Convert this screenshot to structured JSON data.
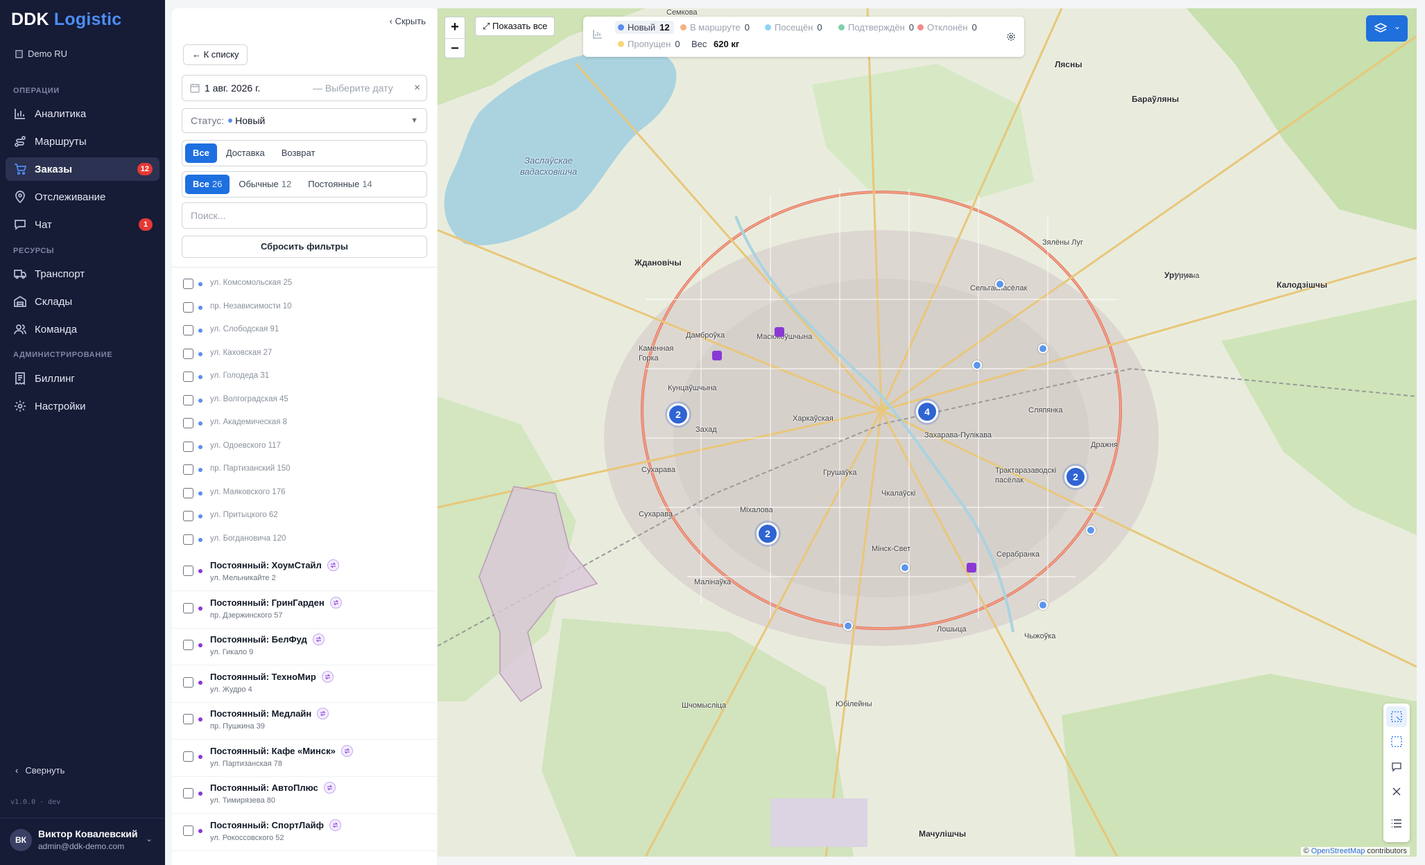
{
  "brand": {
    "part1": "DDK",
    "part2": "Logistic"
  },
  "org": "Demo RU",
  "sidebar": {
    "sections": [
      "ОПЕРАЦИИ",
      "РЕСУРСЫ",
      "АДМИНИСТРИРОВАНИЕ"
    ],
    "items": [
      {
        "label": "Аналитика",
        "icon": "chart-icon"
      },
      {
        "label": "Маршруты",
        "icon": "route-icon"
      },
      {
        "label": "Заказы",
        "icon": "cart-icon",
        "badge": "12",
        "active": true
      },
      {
        "label": "Отслеживание",
        "icon": "pin-icon"
      },
      {
        "label": "Чат",
        "icon": "chat-icon",
        "badge": "1"
      },
      {
        "label": "Транспорт",
        "icon": "truck-icon"
      },
      {
        "label": "Склады",
        "icon": "warehouse-icon"
      },
      {
        "label": "Команда",
        "icon": "users-icon"
      },
      {
        "label": "Биллинг",
        "icon": "receipt-icon"
      },
      {
        "label": "Настройки",
        "icon": "gear-icon"
      }
    ],
    "collapse": "Свернуть",
    "version": "v1.0.0 · dev",
    "user": {
      "initials": "ВК",
      "name": "Виктор Ковалевский",
      "email": "admin@ddk-demo.com"
    }
  },
  "panel": {
    "hide": "Скрыть",
    "back": "К списку",
    "date_from": "1 авг. 2026 г.",
    "date_to_placeholder": "Выберите дату",
    "status_label": "Статус:",
    "status_value": "Новый",
    "type_tabs": [
      "Все",
      "Доставка",
      "Возврат"
    ],
    "kind_tabs": [
      {
        "label": "Все",
        "count": "26"
      },
      {
        "label": "Обычные",
        "count": "12"
      },
      {
        "label": "Постоянные",
        "count": "14"
      }
    ],
    "search_placeholder": "Поиск...",
    "reset": "Сбросить фильтры",
    "simple_orders": [
      "ул. Комсомольская 25",
      "пр. Независимости 10",
      "ул. Слободская 91",
      "ул. Каховская 27",
      "ул. Голодеда 31",
      "ул. Волгоградская 45",
      "ул. Академическая 8",
      "ул. Одоевского 117",
      "пр. Партизанский 150",
      "ул. Маяковского 176",
      "ул. Притыцкого 62",
      "ул. Богдановича 120"
    ],
    "regular_orders": [
      {
        "title": "Постоянный: ХоумСтайл",
        "address": "ул. Мельникайте 2"
      },
      {
        "title": "Постоянный: ГринГарден",
        "address": "пр. Дзержинского 57"
      },
      {
        "title": "Постоянный: БелФуд",
        "address": "ул. Гикало 9"
      },
      {
        "title": "Постоянный: ТехноМир",
        "address": "ул. Жудро 4"
      },
      {
        "title": "Постоянный: Медлайн",
        "address": "пр. Пушкина 39"
      },
      {
        "title": "Постоянный: Кафе «Минск»",
        "address": "ул. Партизанская 78"
      },
      {
        "title": "Постоянный: АвтоПлюс",
        "address": "ул. Тимирязева 80"
      },
      {
        "title": "Постоянный: СпортЛайф",
        "address": "ул. Рокоссовского 52"
      }
    ]
  },
  "map": {
    "show_all": "Показать все",
    "legend": [
      {
        "label": "Новый",
        "count": "12",
        "color": "#5b8def"
      },
      {
        "label": "В маршруте",
        "count": "0",
        "color": "#f4b183"
      },
      {
        "label": "Посещён",
        "count": "0",
        "color": "#8fd3f4"
      },
      {
        "label": "Подтверждён",
        "count": "0",
        "color": "#7fd1a8"
      },
      {
        "label": "Отклонён",
        "count": "0",
        "color": "#f28b8b"
      },
      {
        "label": "Пропущен",
        "count": "0",
        "color": "#f7d774"
      }
    ],
    "weight_label": "Вес",
    "weight_value": "620 кг",
    "clusters": [
      "2",
      "4",
      "2",
      "2"
    ],
    "attribution_prefix": "©",
    "attribution_link": "OpenStreetMap",
    "attribution_suffix": "contributors",
    "labels": [
      "Семкова",
      "Лясны",
      "Бараўляны",
      "Заслаўскае вадасховішча",
      "Ждановічы",
      "Сельгаспасёлак",
      "Зялёны Луг",
      "Уручча",
      "Калодзішчы",
      "Каменная Горка",
      "Дамброўка",
      "Масюкоўшчына",
      "Кунцаўшчына",
      "Захад",
      "Харкаўская",
      "Сухарава",
      "Міхалова",
      "Грушаўка",
      "Чкалаўскі",
      "Мінск-Свет",
      "Серабранка",
      "Лошыца",
      "Чыжоўка",
      "Трактаразаводскі пасёлак",
      "Сляпянка",
      "Малінаўка",
      "Юбілейны",
      "Шчомысліца",
      "Мачулішчы",
      "Дражня",
      "Уручча",
      "Сухарава",
      "Захарава-Пулікава"
    ]
  }
}
